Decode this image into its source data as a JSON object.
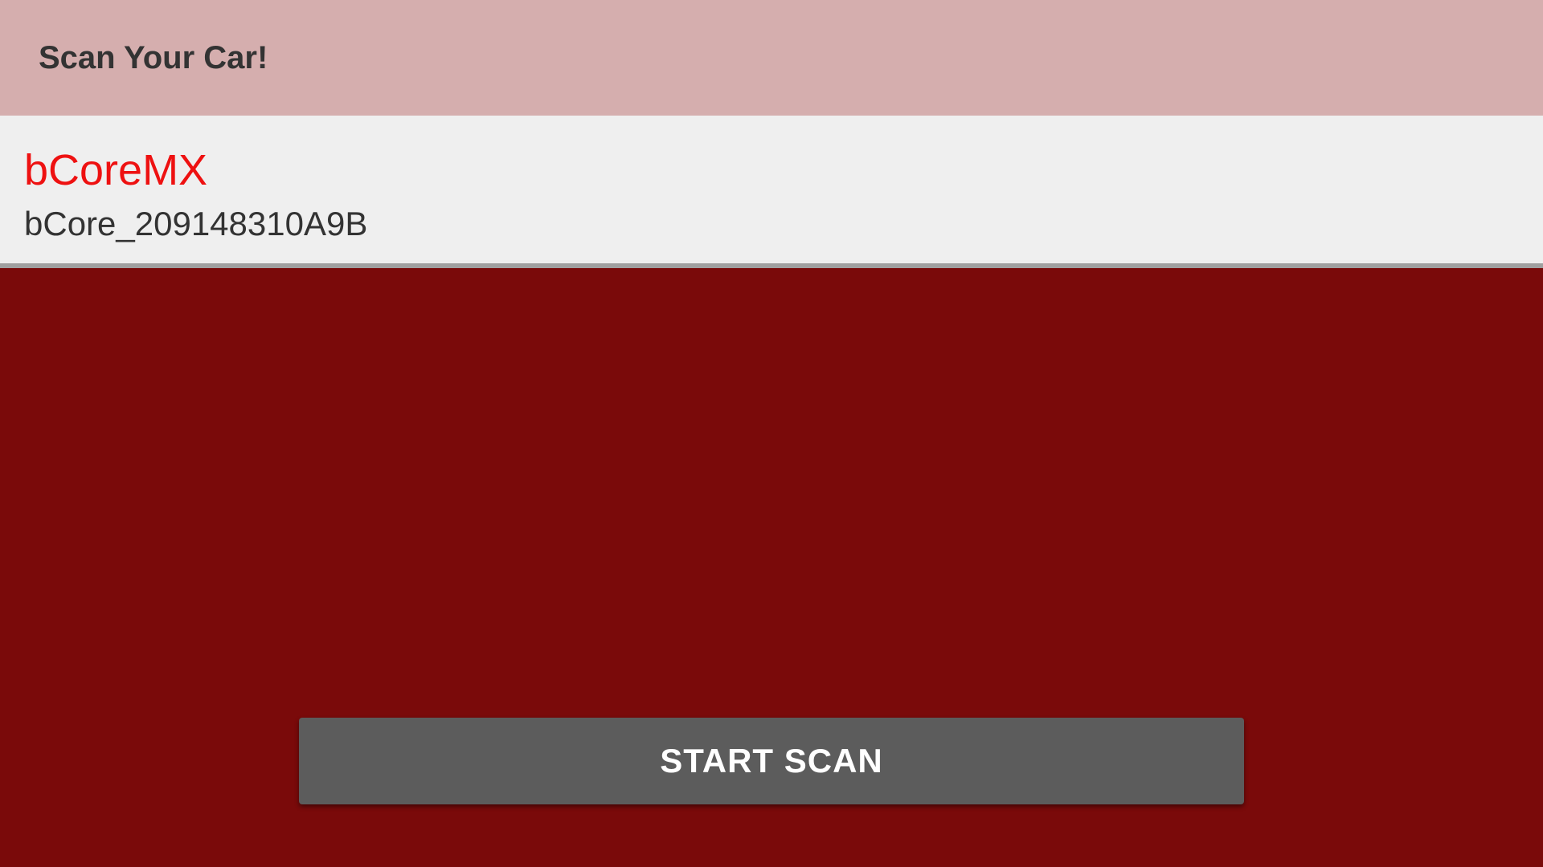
{
  "app_bar": {
    "title": "Scan Your Car!"
  },
  "devices": [
    {
      "name": "bCoreMX",
      "id": "bCore_209148310A9B"
    }
  ],
  "actions": {
    "start_scan_label": "START SCAN"
  },
  "colors": {
    "app_bar_bg": "#d5aeae",
    "main_bg": "#7a0a0a",
    "list_item_bg": "#efefef",
    "device_name": "#ee1111",
    "button_bg": "#5c5c5c"
  }
}
